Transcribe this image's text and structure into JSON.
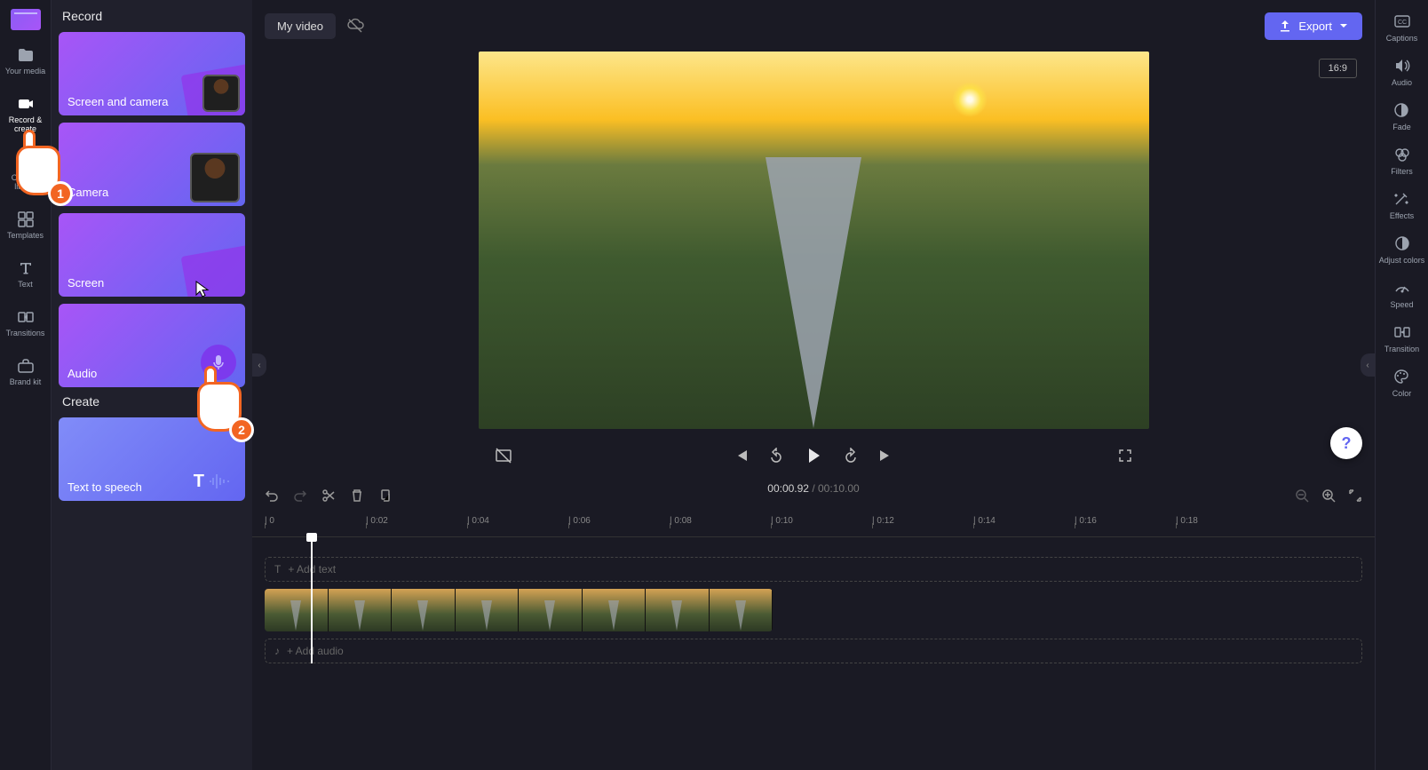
{
  "left_rail": {
    "items": [
      {
        "label": "Your media"
      },
      {
        "label": "Record & create"
      },
      {
        "label": "Content library"
      },
      {
        "label": "Templates"
      },
      {
        "label": "Text"
      },
      {
        "label": "Transitions"
      },
      {
        "label": "Brand kit"
      }
    ]
  },
  "media_panel": {
    "section_record": "Record",
    "cards": {
      "screen_camera": "Screen and camera",
      "camera": "Camera",
      "screen": "Screen",
      "audio": "Audio"
    },
    "section_create": "Create",
    "tts": "Text to speech"
  },
  "topbar": {
    "title": "My video",
    "export": "Export",
    "aspect": "16:9"
  },
  "controls": {
    "time_current": "00:00.92",
    "time_total": "00:10.00"
  },
  "timeline": {
    "ticks": [
      "0",
      "0:02",
      "0:04",
      "0:06",
      "0:08",
      "0:10",
      "0:12",
      "0:14",
      "0:16",
      "0:18"
    ],
    "add_text": "+ Add text",
    "add_audio": "+ Add audio"
  },
  "right_rail": {
    "items": [
      "Captions",
      "Audio",
      "Fade",
      "Filters",
      "Effects",
      "Adjust colors",
      "Speed",
      "Transition",
      "Color"
    ]
  },
  "annotations": {
    "hand1": "1",
    "hand2": "2"
  },
  "help": "?"
}
